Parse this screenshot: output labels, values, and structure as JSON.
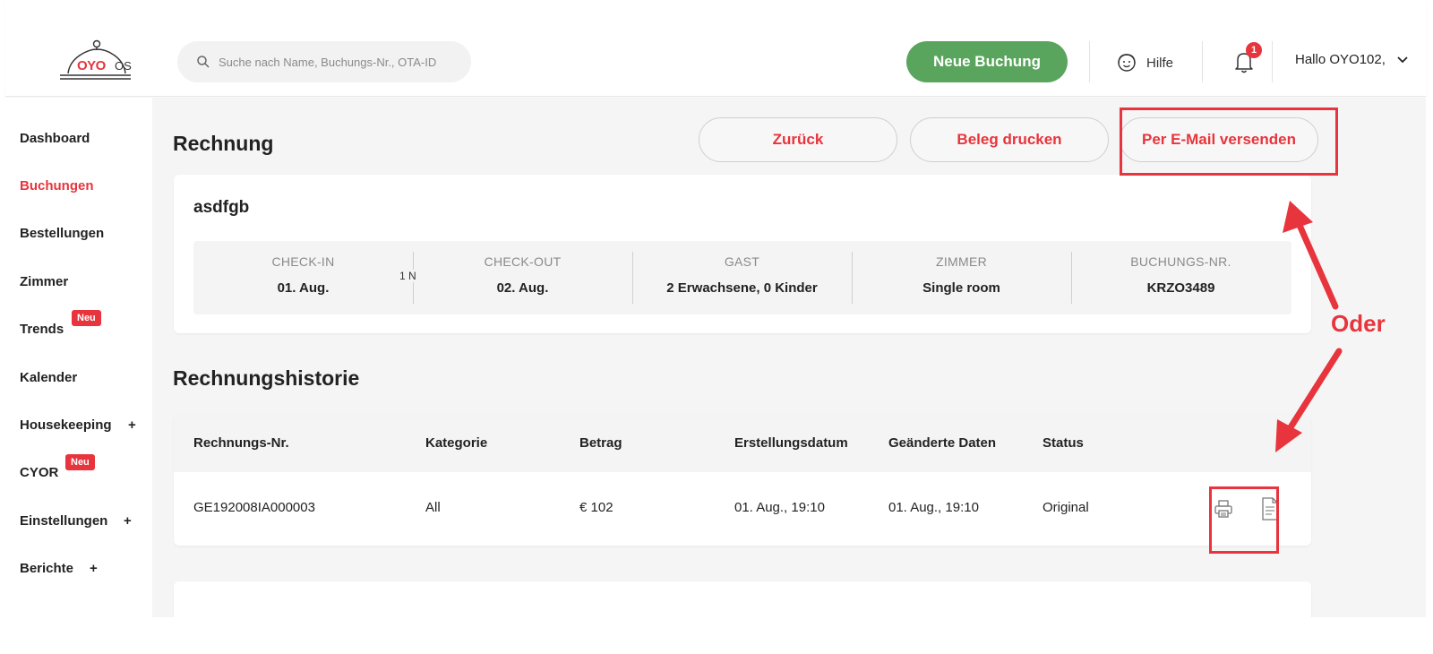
{
  "header": {
    "logo_text": "OYO",
    "logo_suffix": "OS",
    "search_placeholder": "Suche nach Name, Buchungs-Nr., OTA-ID",
    "new_booking_label": "Neue Buchung",
    "help_label": "Hilfe",
    "notification_count": "1",
    "user_greeting": "Hallo OYO102,"
  },
  "sidebar": {
    "items": [
      {
        "label": "Dashboard"
      },
      {
        "label": "Buchungen"
      },
      {
        "label": "Bestellungen"
      },
      {
        "label": "Zimmer"
      },
      {
        "label": "Trends"
      },
      {
        "label": "Kalender"
      },
      {
        "label": "Housekeeping"
      },
      {
        "label": "CYOR"
      },
      {
        "label": "Einstellungen"
      },
      {
        "label": "Berichte"
      }
    ],
    "new_badge": "Neu",
    "expand_symbol": "+"
  },
  "page": {
    "title": "Rechnung",
    "back_label": "Zurück",
    "print_label": "Beleg drucken",
    "email_label": "Per E-Mail versenden"
  },
  "booking": {
    "guest_name": "asdfgb",
    "nights": "1 N",
    "columns": [
      {
        "label": "CHECK-IN",
        "value": "01. Aug."
      },
      {
        "label": "CHECK-OUT",
        "value": "02. Aug."
      },
      {
        "label": "GAST",
        "value": "2 Erwachsene, 0 Kinder"
      },
      {
        "label": "ZIMMER",
        "value": "Single room"
      },
      {
        "label": "BUCHUNGS-NR.",
        "value": "KRZO3489"
      }
    ]
  },
  "history": {
    "title": "Rechnungshistorie",
    "headers": [
      "Rechnungs-Nr.",
      "Kategorie",
      "Betrag",
      "Erstellungsdatum",
      "Geänderte Daten",
      "Status"
    ],
    "rows": [
      [
        "GE192008IA000003",
        "All",
        "€ 102",
        "01. Aug., 19:10",
        "01. Aug., 19:10",
        "Original"
      ]
    ]
  },
  "annotation": {
    "label": "Oder",
    "color": "#e8343c"
  },
  "colors": {
    "brand_red": "#e8343c",
    "primary_green": "#5aa55d"
  }
}
